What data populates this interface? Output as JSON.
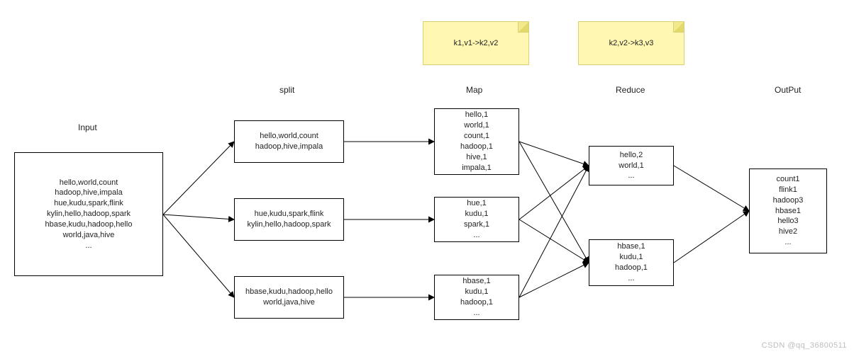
{
  "stage_labels": {
    "input": "Input",
    "split": "split",
    "map": "Map",
    "reduce": "Reduce",
    "output": "OutPut"
  },
  "notes": {
    "map_note": "k1,v1->k2,v2",
    "reduce_note": "k2,v2->k3,v3"
  },
  "input_box": {
    "l1": "hello,world,count",
    "l2": "hadoop,hive,impala",
    "l3": "hue,kudu,spark,flink",
    "l4": "kylin,hello,hadoop,spark",
    "l5": "hbase,kudu,hadoop,hello",
    "l6": "world,java,hive",
    "l7": "..."
  },
  "split_boxes": {
    "s1": {
      "l1": "hello,world,count",
      "l2": "hadoop,hive,impala"
    },
    "s2": {
      "l1": "hue,kudu,spark,flink",
      "l2": "kylin,hello,hadoop,spark"
    },
    "s3": {
      "l1": "hbase,kudu,hadoop,hello",
      "l2": "world,java,hive"
    }
  },
  "map_boxes": {
    "m1": {
      "l1": "hello,1",
      "l2": "world,1",
      "l3": "count,1",
      "l4": "hadoop,1",
      "l5": "hive,1",
      "l6": "impala,1"
    },
    "m2": {
      "l1": "hue,1",
      "l2": "kudu,1",
      "l3": "spark,1",
      "l4": "..."
    },
    "m3": {
      "l1": "hbase,1",
      "l2": "kudu,1",
      "l3": "hadoop,1",
      "l4": "..."
    }
  },
  "reduce_boxes": {
    "r1": {
      "l1": "hello,2",
      "l2": "world,1",
      "l3": "..."
    },
    "r2": {
      "l1": "hbase,1",
      "l2": "kudu,1",
      "l3": "hadoop,1",
      "l4": "..."
    }
  },
  "output_box": {
    "l1": "count1",
    "l2": "flink1",
    "l3": "hadoop3",
    "l4": "hbase1",
    "l5": "hello3",
    "l6": "hive2",
    "l7": "..."
  },
  "watermark": "CSDN @qq_36800511",
  "chart_data": {
    "type": "table",
    "title": "MapReduce word-count dataflow",
    "stages": [
      "Input",
      "split",
      "Map",
      "Reduce",
      "OutPut"
    ],
    "input_lines": [
      "hello,world,count",
      "hadoop,hive,impala",
      "hue,kudu,spark,flink",
      "kylin,hello,hadoop,spark",
      "hbase,kudu,hadoop,hello",
      "world,java,hive",
      "..."
    ],
    "splits": [
      [
        "hello,world,count",
        "hadoop,hive,impala"
      ],
      [
        "hue,kudu,spark,flink",
        "kylin,hello,hadoop,spark"
      ],
      [
        "hbase,kudu,hadoop,hello",
        "world,java,hive"
      ]
    ],
    "map_outputs": [
      [
        [
          "hello",
          1
        ],
        [
          "world",
          1
        ],
        [
          "count",
          1
        ],
        [
          "hadoop",
          1
        ],
        [
          "hive",
          1
        ],
        [
          "impala",
          1
        ]
      ],
      [
        [
          "hue",
          1
        ],
        [
          "kudu",
          1
        ],
        [
          "spark",
          1
        ],
        "..."
      ],
      [
        [
          "hbase",
          1
        ],
        [
          "kudu",
          1
        ],
        [
          "hadoop",
          1
        ],
        "..."
      ]
    ],
    "reduce_outputs": [
      [
        [
          "hello",
          2
        ],
        [
          "world",
          1
        ],
        "..."
      ],
      [
        [
          "hbase",
          1
        ],
        [
          "kudu",
          1
        ],
        [
          "hadoop",
          1
        ],
        "..."
      ]
    ],
    "final_output": [
      [
        "count",
        1
      ],
      [
        "flink",
        1
      ],
      [
        "hadoop",
        3
      ],
      [
        "hbase",
        1
      ],
      [
        "hello",
        3
      ],
      [
        "hive",
        2
      ],
      "..."
    ],
    "annotations": {
      "map_transform": "k1,v1->k2,v2",
      "reduce_transform": "k2,v2->k3,v3"
    }
  }
}
